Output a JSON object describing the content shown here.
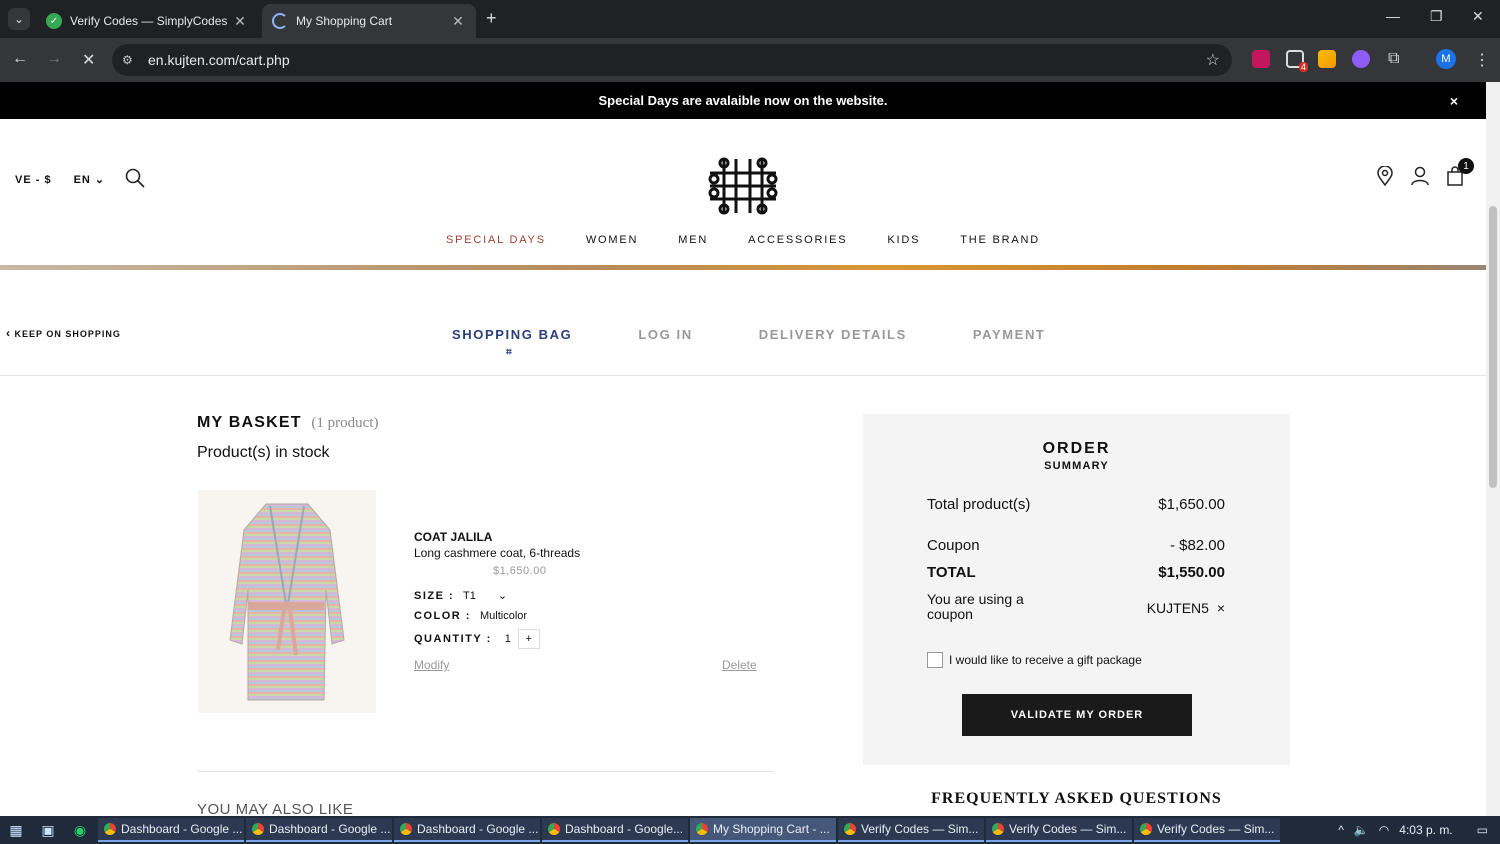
{
  "browser": {
    "tabs": [
      {
        "title": "Verify Codes — SimplyCodes",
        "active": false
      },
      {
        "title": "My Shopping Cart",
        "active": true
      }
    ],
    "url": "en.kujten.com/cart.php",
    "profile_initial": "M",
    "ext_badge": "4"
  },
  "announcement": {
    "text": "Special Days are avalaible now on the website.",
    "close": "×"
  },
  "header": {
    "region": "VE - $",
    "language": "EN",
    "cart_count": "1"
  },
  "nav": [
    "SPECIAL DAYS",
    "WOMEN",
    "MEN",
    "ACCESSORIES",
    "KIDS",
    "THE BRAND"
  ],
  "checkout": {
    "keep_shopping": "KEEP ON SHOPPING",
    "steps": [
      "SHOPPING BAG",
      "LOG IN",
      "DELIVERY DETAILS",
      "PAYMENT"
    ]
  },
  "basket": {
    "title": "MY BASKET",
    "count": "(1 product)",
    "stock_label": "Product(s) in stock",
    "product": {
      "name": "COAT JALILA",
      "description": "Long cashmere coat, 6-threads",
      "price": "$1,650.00",
      "size_label": "SIZE :",
      "size_value": "T1",
      "color_label": "COLOR :",
      "color_value": "Multicolor",
      "quantity_label": "QUANTITY :",
      "quantity_value": "1",
      "modify": "Modify",
      "delete": "Delete"
    },
    "also_like": "YOU MAY ALSO LIKE"
  },
  "summary": {
    "title": "ORDER",
    "subtitle": "SUMMARY",
    "total_products_label": "Total product(s)",
    "total_products_value": "$1,650.00",
    "coupon_label": "Coupon",
    "coupon_value": "- $82.00",
    "total_label": "TOTAL",
    "total_value": "$1,550.00",
    "using_coupon": "You are using a coupon",
    "coupon_code": "KUJTEN5",
    "gift_label": "I would like to receive a gift package",
    "validate": "VALIDATE MY ORDER",
    "faq": "FREQUENTLY ASKED QUESTIONS"
  },
  "taskbar": {
    "apps": [
      "Dashboard - Google ...",
      "Dashboard - Google ...",
      "Dashboard - Google ...",
      "Dashboard - Google...",
      "My Shopping Cart - ...",
      "Verify Codes — Sim...",
      "Verify Codes — Sim...",
      "Verify Codes — Sim..."
    ],
    "time": "4:03 p. m."
  }
}
